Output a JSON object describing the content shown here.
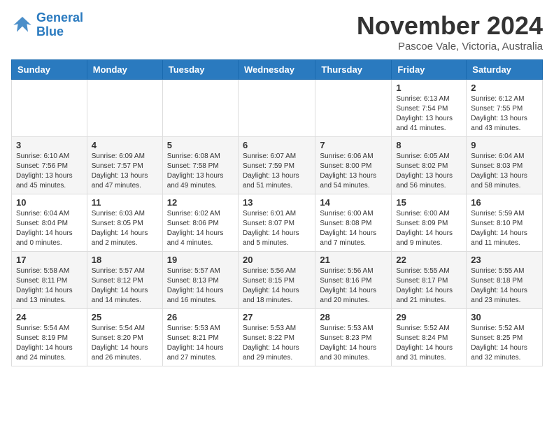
{
  "logo": {
    "line1": "General",
    "line2": "Blue"
  },
  "title": "November 2024",
  "location": "Pascoe Vale, Victoria, Australia",
  "days_of_week": [
    "Sunday",
    "Monday",
    "Tuesday",
    "Wednesday",
    "Thursday",
    "Friday",
    "Saturday"
  ],
  "weeks": [
    [
      {
        "day": "",
        "info": ""
      },
      {
        "day": "",
        "info": ""
      },
      {
        "day": "",
        "info": ""
      },
      {
        "day": "",
        "info": ""
      },
      {
        "day": "",
        "info": ""
      },
      {
        "day": "1",
        "info": "Sunrise: 6:13 AM\nSunset: 7:54 PM\nDaylight: 13 hours\nand 41 minutes."
      },
      {
        "day": "2",
        "info": "Sunrise: 6:12 AM\nSunset: 7:55 PM\nDaylight: 13 hours\nand 43 minutes."
      }
    ],
    [
      {
        "day": "3",
        "info": "Sunrise: 6:10 AM\nSunset: 7:56 PM\nDaylight: 13 hours\nand 45 minutes."
      },
      {
        "day": "4",
        "info": "Sunrise: 6:09 AM\nSunset: 7:57 PM\nDaylight: 13 hours\nand 47 minutes."
      },
      {
        "day": "5",
        "info": "Sunrise: 6:08 AM\nSunset: 7:58 PM\nDaylight: 13 hours\nand 49 minutes."
      },
      {
        "day": "6",
        "info": "Sunrise: 6:07 AM\nSunset: 7:59 PM\nDaylight: 13 hours\nand 51 minutes."
      },
      {
        "day": "7",
        "info": "Sunrise: 6:06 AM\nSunset: 8:00 PM\nDaylight: 13 hours\nand 54 minutes."
      },
      {
        "day": "8",
        "info": "Sunrise: 6:05 AM\nSunset: 8:02 PM\nDaylight: 13 hours\nand 56 minutes."
      },
      {
        "day": "9",
        "info": "Sunrise: 6:04 AM\nSunset: 8:03 PM\nDaylight: 13 hours\nand 58 minutes."
      }
    ],
    [
      {
        "day": "10",
        "info": "Sunrise: 6:04 AM\nSunset: 8:04 PM\nDaylight: 14 hours\nand 0 minutes."
      },
      {
        "day": "11",
        "info": "Sunrise: 6:03 AM\nSunset: 8:05 PM\nDaylight: 14 hours\nand 2 minutes."
      },
      {
        "day": "12",
        "info": "Sunrise: 6:02 AM\nSunset: 8:06 PM\nDaylight: 14 hours\nand 4 minutes."
      },
      {
        "day": "13",
        "info": "Sunrise: 6:01 AM\nSunset: 8:07 PM\nDaylight: 14 hours\nand 5 minutes."
      },
      {
        "day": "14",
        "info": "Sunrise: 6:00 AM\nSunset: 8:08 PM\nDaylight: 14 hours\nand 7 minutes."
      },
      {
        "day": "15",
        "info": "Sunrise: 6:00 AM\nSunset: 8:09 PM\nDaylight: 14 hours\nand 9 minutes."
      },
      {
        "day": "16",
        "info": "Sunrise: 5:59 AM\nSunset: 8:10 PM\nDaylight: 14 hours\nand 11 minutes."
      }
    ],
    [
      {
        "day": "17",
        "info": "Sunrise: 5:58 AM\nSunset: 8:11 PM\nDaylight: 14 hours\nand 13 minutes."
      },
      {
        "day": "18",
        "info": "Sunrise: 5:57 AM\nSunset: 8:12 PM\nDaylight: 14 hours\nand 14 minutes."
      },
      {
        "day": "19",
        "info": "Sunrise: 5:57 AM\nSunset: 8:13 PM\nDaylight: 14 hours\nand 16 minutes."
      },
      {
        "day": "20",
        "info": "Sunrise: 5:56 AM\nSunset: 8:15 PM\nDaylight: 14 hours\nand 18 minutes."
      },
      {
        "day": "21",
        "info": "Sunrise: 5:56 AM\nSunset: 8:16 PM\nDaylight: 14 hours\nand 20 minutes."
      },
      {
        "day": "22",
        "info": "Sunrise: 5:55 AM\nSunset: 8:17 PM\nDaylight: 14 hours\nand 21 minutes."
      },
      {
        "day": "23",
        "info": "Sunrise: 5:55 AM\nSunset: 8:18 PM\nDaylight: 14 hours\nand 23 minutes."
      }
    ],
    [
      {
        "day": "24",
        "info": "Sunrise: 5:54 AM\nSunset: 8:19 PM\nDaylight: 14 hours\nand 24 minutes."
      },
      {
        "day": "25",
        "info": "Sunrise: 5:54 AM\nSunset: 8:20 PM\nDaylight: 14 hours\nand 26 minutes."
      },
      {
        "day": "26",
        "info": "Sunrise: 5:53 AM\nSunset: 8:21 PM\nDaylight: 14 hours\nand 27 minutes."
      },
      {
        "day": "27",
        "info": "Sunrise: 5:53 AM\nSunset: 8:22 PM\nDaylight: 14 hours\nand 29 minutes."
      },
      {
        "day": "28",
        "info": "Sunrise: 5:53 AM\nSunset: 8:23 PM\nDaylight: 14 hours\nand 30 minutes."
      },
      {
        "day": "29",
        "info": "Sunrise: 5:52 AM\nSunset: 8:24 PM\nDaylight: 14 hours\nand 31 minutes."
      },
      {
        "day": "30",
        "info": "Sunrise: 5:52 AM\nSunset: 8:25 PM\nDaylight: 14 hours\nand 32 minutes."
      }
    ]
  ]
}
